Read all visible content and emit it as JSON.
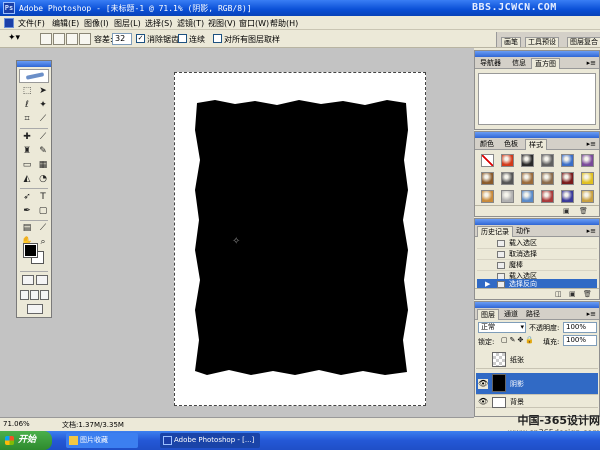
{
  "window": {
    "title": "Adobe Photoshop - [未标题-1 @ 71.1% (阴影, RGB/8)]",
    "watermark": "BBS.JCWCN.COM"
  },
  "menu": [
    "文件(F)",
    "编辑(E)",
    "图像(I)",
    "图层(L)",
    "选择(S)",
    "滤镜(T)",
    "视图(V)",
    "窗口(W)",
    "帮助(H)"
  ],
  "options": {
    "tolerance_label": "容差:",
    "tolerance_value": "32",
    "anti_alias_label": "消除锯齿",
    "anti_alias_checked": true,
    "contiguous_label": "连续",
    "contiguous_checked": false,
    "all_layers_label": "对所有图层取样",
    "all_layers_checked": false,
    "well_tabs": [
      "画笔",
      "工具预设",
      "图层复合"
    ]
  },
  "navigator": {
    "tabs": [
      "导航器",
      "信息",
      "直方图"
    ],
    "active_tab": "直方图"
  },
  "styles": {
    "tabs": [
      "颜色",
      "色板",
      "样式"
    ],
    "active_tab": "样式",
    "swatch_colors": [
      "#ffffff",
      "#d23a1a",
      "#2a2a2a",
      "#606060",
      "#3a6ec8",
      "#7a4a9a",
      "#8a5a2a",
      "#555555",
      "#9a6a3a",
      "#8a6a4a",
      "#7a1a1a",
      "#e0c020",
      "#c88a3a",
      "#b0b0b0",
      "#5a8ac8",
      "#aa3a3a",
      "#3a3a9a",
      "#c8a040"
    ]
  },
  "history": {
    "tabs": [
      "历史记录",
      "动作"
    ],
    "active_tab": "历史记录",
    "items": [
      {
        "label": "载入选区",
        "selected": false
      },
      {
        "label": "取消选择",
        "selected": false
      },
      {
        "label": "魔棒",
        "selected": false
      },
      {
        "label": "载入选区",
        "selected": false
      },
      {
        "label": "选择反向",
        "selected": true
      }
    ]
  },
  "layers": {
    "tabs": [
      "图层",
      "通道",
      "路径"
    ],
    "active_tab": "图层",
    "blend_mode": "正常",
    "opacity_label": "不透明度:",
    "opacity": "100%",
    "lock_label": "锁定:",
    "fill_label": "填充:",
    "fill": "100%",
    "items": [
      {
        "name": "纸张",
        "visible": false,
        "selected": false,
        "thumb": "checker"
      },
      {
        "name": "阴影",
        "visible": true,
        "selected": true,
        "thumb": "#000000"
      },
      {
        "name": "背景",
        "visible": true,
        "selected": false,
        "thumb": "#ffffff"
      }
    ]
  },
  "status": {
    "zoom": "71.06%",
    "doc_info": "文档:1.37M/3.35M"
  },
  "taskbar": {
    "start_label": "开始",
    "tasks": [
      {
        "label": "图片收藏",
        "active": false
      },
      {
        "label": "Adobe Photoshop - [...]",
        "active": true
      }
    ]
  },
  "site_watermark": {
    "line1": "中国-365设计网",
    "line2": "www.cn365design.com"
  }
}
